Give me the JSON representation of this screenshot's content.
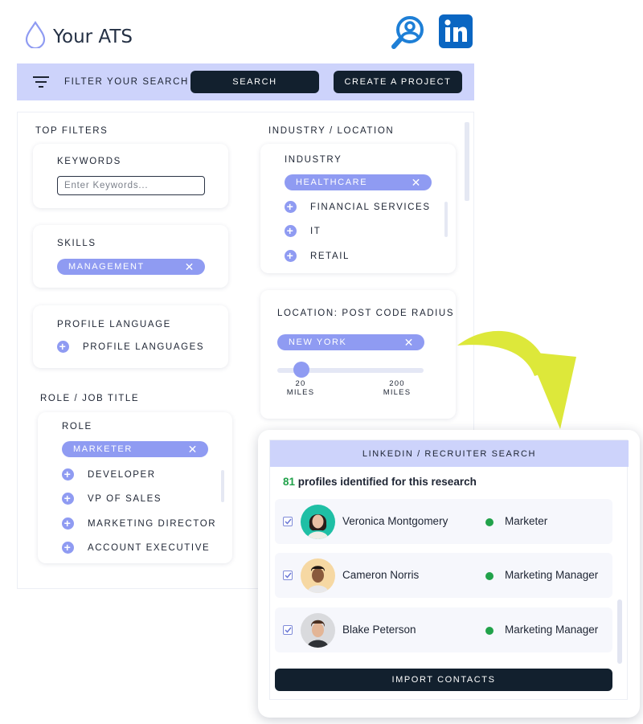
{
  "app": {
    "brand": "Your ATS"
  },
  "toolbar": {
    "filter_label": "FILTER YOUR SEARCH",
    "search_label": "SEARCH",
    "create_project_label": "CREATE A PROJECT"
  },
  "top_filters": {
    "title": "TOP FILTERS",
    "keywords": {
      "label": "KEYWORDS",
      "placeholder": "Enter Keywords..."
    },
    "skills": {
      "label": "SKILLS",
      "selected": "MANAGEMENT"
    },
    "profile_language": {
      "label": "PROFILE LANGUAGE",
      "option": "PROFILE LANGUAGES"
    }
  },
  "role_job_title": {
    "title": "ROLE / JOB TITLE",
    "label": "ROLE",
    "selected": "MARKETER",
    "options": [
      "DEVELOPER",
      "VP OF SALES",
      "MARKETING DIRECTOR",
      "ACCOUNT EXECUTIVE"
    ]
  },
  "industry_location": {
    "title": "INDUSTRY / LOCATION",
    "industry": {
      "label": "INDUSTRY",
      "selected": "HEALTHCARE",
      "options": [
        "FINANCIAL SERVICES",
        "IT",
        "RETAIL"
      ]
    },
    "location": {
      "label": "LOCATION: POST CODE RADIUS",
      "selected": "NEW YORK",
      "slider_value_fraction": 0.16,
      "min_label_num": "20",
      "min_label_unit": "MILES",
      "max_label_num": "200",
      "max_label_unit": "MILES"
    }
  },
  "results": {
    "title": "LINKEDIN / RECRUITER SEARCH",
    "count": "81",
    "count_text": " profiles identified for this research",
    "profiles": [
      {
        "name": "Veronica Montgomery",
        "role": "Marketer"
      },
      {
        "name": "Cameron Norris",
        "role": "Marketing Manager"
      },
      {
        "name": "Blake Peterson",
        "role": "Marketing Manager"
      }
    ],
    "import_label": "IMPORT CONTACTS"
  },
  "colors": {
    "accent": "#8f9bf2",
    "toolbar_bg": "#cdd3fb",
    "dark_button": "#12202e",
    "status_green": "#21a24a",
    "arrow": "#dde83a"
  },
  "icons": [
    "droplet-logo-icon",
    "search-person-icon",
    "linkedin-icon",
    "filter-lines-icon",
    "plus-icon",
    "close-icon",
    "checkbox-icon",
    "curved-arrow-icon"
  ]
}
